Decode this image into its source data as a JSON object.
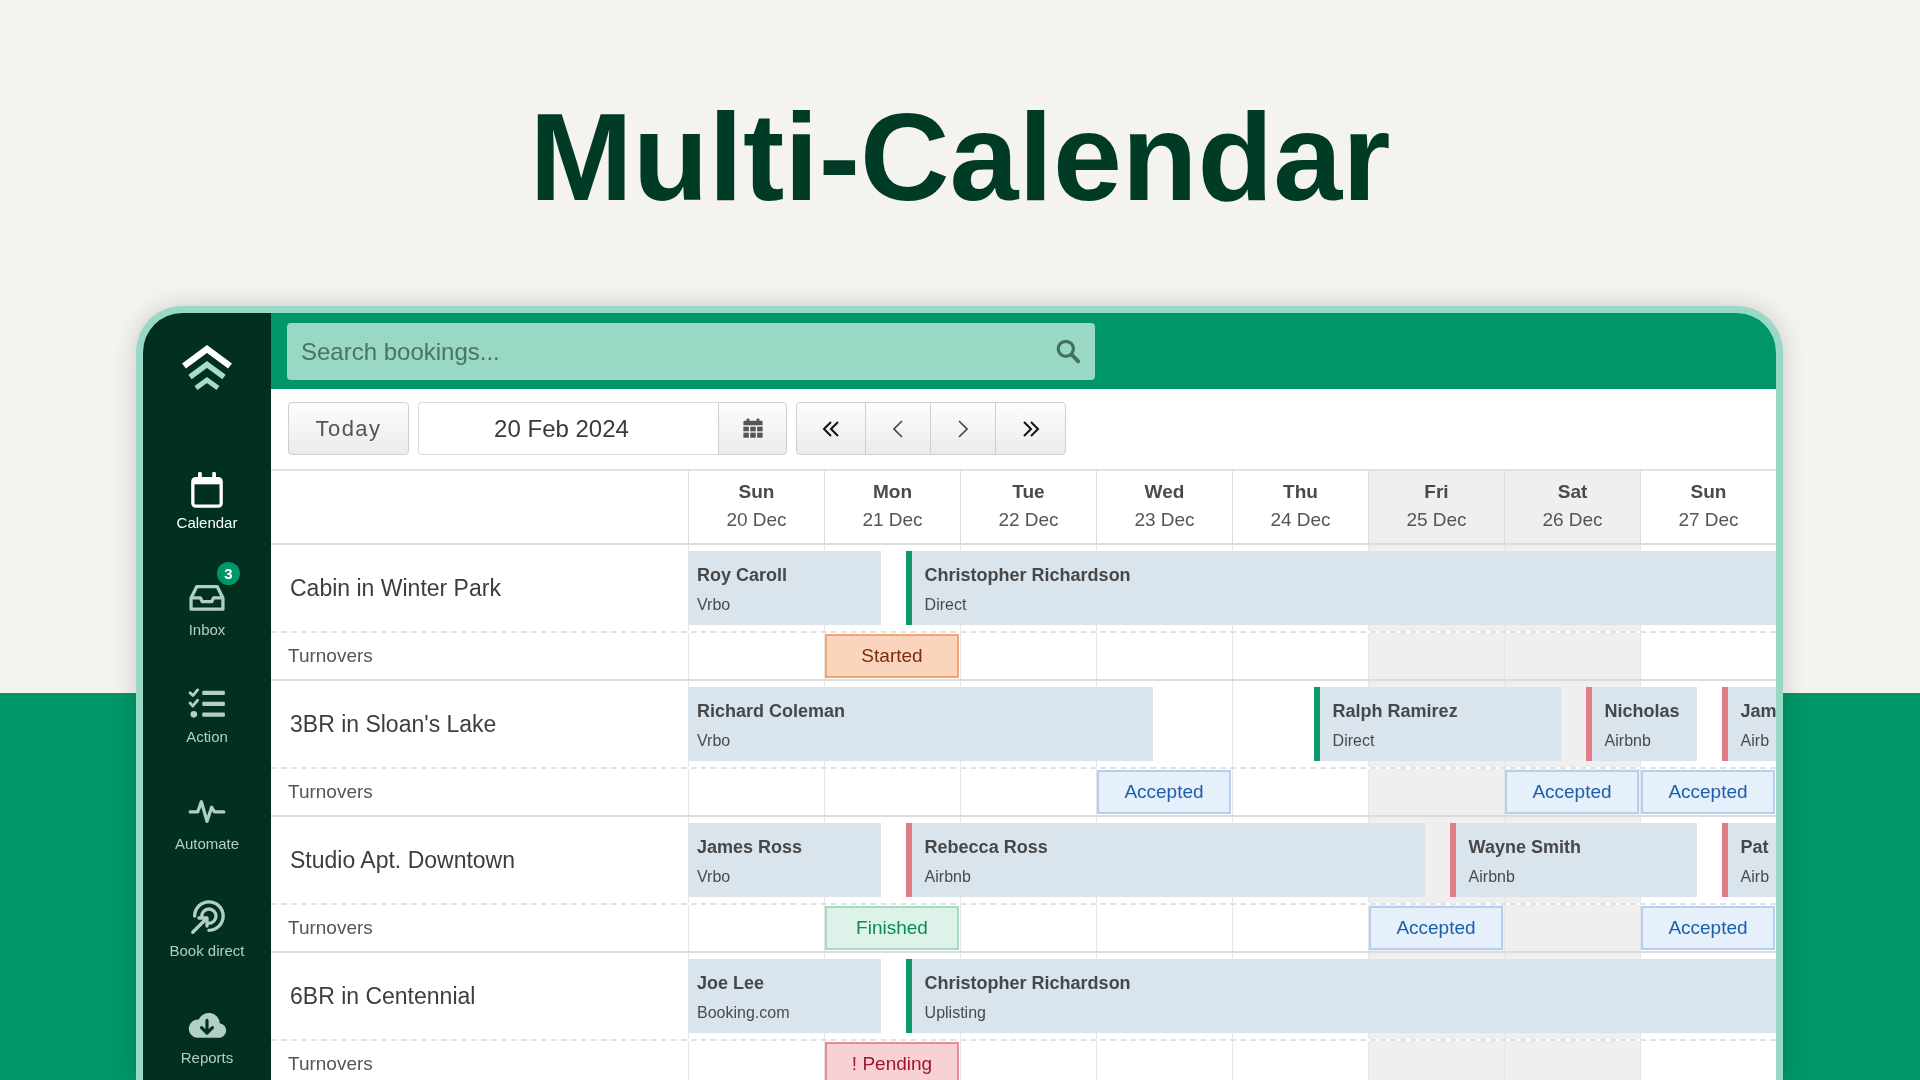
{
  "title": "Multi-Calendar",
  "sidebar": {
    "items": [
      {
        "label": "Calendar",
        "selected": true
      },
      {
        "label": "Inbox",
        "selected": false,
        "badge": "3"
      },
      {
        "label": "Action",
        "selected": false
      },
      {
        "label": "Automate",
        "selected": false
      },
      {
        "label": "Book direct",
        "selected": false
      },
      {
        "label": "Reports",
        "selected": false
      }
    ]
  },
  "search": {
    "placeholder": "Search bookings..."
  },
  "toolbar": {
    "today_button": "Today",
    "date": "20 Feb 2024"
  },
  "days": [
    {
      "weekday": "Sun",
      "date": "20 Dec",
      "shaded": false
    },
    {
      "weekday": "Mon",
      "date": "21 Dec",
      "shaded": false
    },
    {
      "weekday": "Tue",
      "date": "22 Dec",
      "shaded": false
    },
    {
      "weekday": "Wed",
      "date": "23 Dec",
      "shaded": false
    },
    {
      "weekday": "Thu",
      "date": "24 Dec",
      "shaded": false
    },
    {
      "weekday": "Fri",
      "date": "25 Dec",
      "shaded": true
    },
    {
      "weekday": "Sat",
      "date": "26 Dec",
      "shaded": true
    },
    {
      "weekday": "Sun",
      "date": "27 Dec",
      "shaded": false
    }
  ],
  "properties": [
    {
      "name": "Cabin in Winter Park",
      "turnover_label": "Turnovers",
      "timeline": [
        {
          "kind": "stay",
          "booking": {
            "guest": "Roy Caroll",
            "source": "Vrbo"
          }
        },
        {
          "kind": "changeover",
          "booking": {
            "guest": "Christopher Richardson",
            "source": "Direct",
            "color": "#0e9a6b"
          },
          "turnover": {
            "status": "Started",
            "kind": "started"
          }
        },
        {
          "kind": "stay"
        },
        {
          "kind": "stay"
        },
        {
          "kind": "stay"
        },
        {
          "kind": "stay"
        },
        {
          "kind": "stay"
        },
        {
          "kind": "stay"
        }
      ]
    },
    {
      "name": "3BR in Sloan's Lake",
      "turnover_label": "Turnovers",
      "timeline": [
        {
          "kind": "stay",
          "booking": {
            "guest": "Richard Coleman",
            "source": "Vrbo"
          }
        },
        {
          "kind": "stay"
        },
        {
          "kind": "stay"
        },
        {
          "kind": "check_out",
          "turnover": {
            "status": "Accepted",
            "kind": "accepted"
          }
        },
        {
          "kind": "check_in",
          "booking": {
            "guest": "Ralph Ramirez",
            "source": "Direct",
            "color": "#0e9a6b"
          }
        },
        {
          "kind": "stay"
        },
        {
          "kind": "changeover",
          "booking": {
            "guest": "Nicholas",
            "source": "Airbnb",
            "color": "#e27d87"
          },
          "turnover": {
            "status": "Accepted",
            "kind": "accepted"
          }
        },
        {
          "kind": "changeover",
          "booking": {
            "guest": "Jam",
            "source": "Airb",
            "color": "#e27d87"
          },
          "turnover": {
            "status": "Accepted",
            "kind": "accepted"
          }
        }
      ]
    },
    {
      "name": "Studio Apt. Downtown",
      "turnover_label": "Turnovers",
      "timeline": [
        {
          "kind": "stay",
          "booking": {
            "guest": "James Ross",
            "source": "Vrbo"
          }
        },
        {
          "kind": "changeover",
          "booking": {
            "guest": "Rebecca Ross",
            "source": "Airbnb",
            "color": "#e27d87"
          },
          "turnover": {
            "status": "Finished",
            "kind": "finished"
          }
        },
        {
          "kind": "stay"
        },
        {
          "kind": "stay"
        },
        {
          "kind": "stay"
        },
        {
          "kind": "changeover",
          "booking": {
            "guest": "Wayne Smith",
            "source": "Airbnb",
            "color": "#e27d87"
          },
          "turnover": {
            "status": "Accepted",
            "kind": "accepted"
          }
        },
        {
          "kind": "stay"
        },
        {
          "kind": "changeover",
          "booking": {
            "guest": "Pat",
            "source": "Airb",
            "color": "#e27d87"
          },
          "turnover": {
            "status": "Accepted",
            "kind": "accepted"
          }
        }
      ]
    },
    {
      "name": "6BR in Centennial",
      "turnover_label": "Turnovers",
      "timeline": [
        {
          "kind": "stay",
          "booking": {
            "guest": "Joe Lee",
            "source": "Booking.com"
          }
        },
        {
          "kind": "changeover",
          "booking": {
            "guest": "Christopher Richardson",
            "source": "Uplisting",
            "color": "#0e9a6b"
          },
          "turnover": {
            "status": "! Pending",
            "kind": "pending"
          }
        },
        {
          "kind": "stay"
        },
        {
          "kind": "stay"
        },
        {
          "kind": "stay"
        },
        {
          "kind": "stay"
        },
        {
          "kind": "stay"
        },
        {
          "kind": "stay"
        }
      ]
    }
  ]
}
